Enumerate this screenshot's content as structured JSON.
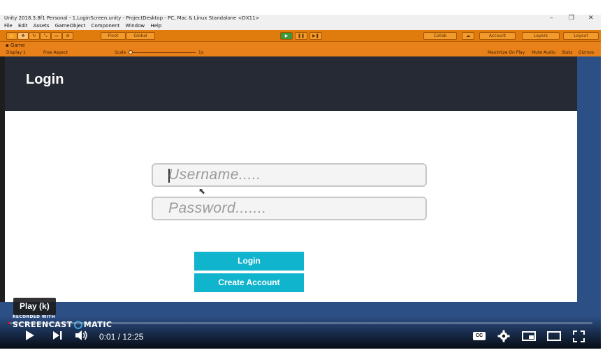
{
  "unity": {
    "window_title": "Unity 2018.3.8f1 Personal - 1.LoginScreen.unity - ProjectDesktop - PC, Mac & Linux Standalone <DX11>",
    "window_controls": [
      "–",
      "❐",
      "✕"
    ],
    "menu": [
      "File",
      "Edit",
      "Assets",
      "GameObject",
      "Component",
      "Window",
      "Help"
    ],
    "toolbar": {
      "pivot_label": "Pivot",
      "global_label": "Global",
      "collab_label": "Collab",
      "account_label": "Account",
      "layers_label": "Layers",
      "layout_label": "Layout"
    },
    "game_tab_label": "Game",
    "display_label": "Display 1",
    "aspect_label": "Free Aspect",
    "scale_label": "Scale",
    "scale_value": "1x",
    "maximize_label": "Maximize On Play",
    "mute_label": "Mute Audio",
    "stats_label": "Stats",
    "gizmos_label": "Gizmos"
  },
  "game": {
    "header_title": "Login",
    "username_placeholder": "Username.....",
    "password_placeholder": "Password.......",
    "login_button": "Login",
    "create_account_button": "Create Account",
    "accent_color": "#11b4cd",
    "header_color": "#252a34"
  },
  "player": {
    "tooltip": "Play (k)",
    "watermark_recorded": "RECORDED WITH",
    "watermark_brand_left": "SCREENCAST",
    "watermark_brand_right": "MATIC",
    "time_current": "0:01",
    "time_separator": " / ",
    "time_total": "12:25",
    "progress_fraction": 0.0013,
    "cc_label": "CC"
  }
}
